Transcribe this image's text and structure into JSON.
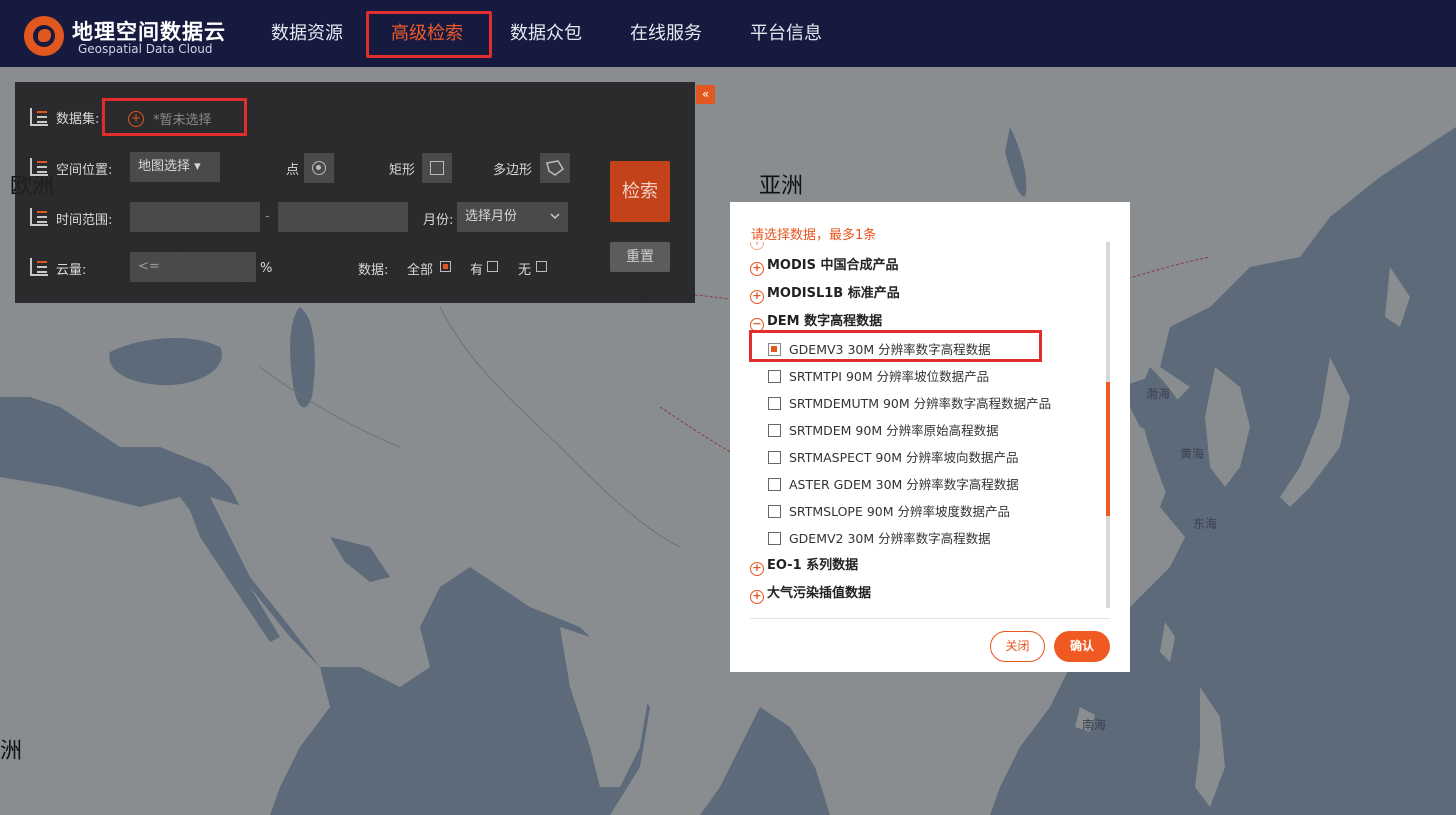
{
  "header": {
    "logo_cn": "地理空间数据云",
    "logo_en": "Geospatial Data Cloud",
    "nav": [
      "数据资源",
      "高级检索",
      "数据众包",
      "在线服务",
      "平台信息"
    ],
    "active_nav": "高级检索"
  },
  "map": {
    "continents": [
      "欧洲",
      "亚洲",
      "洲"
    ],
    "seas": [
      "渤海",
      "黄海",
      "东海",
      "南海"
    ]
  },
  "search_panel": {
    "collapse_icon": "«",
    "dataset_label": "数据集:",
    "dataset_placeholder": "*暂未选择",
    "location_label": "空间位置:",
    "map_select": "地图选择 ▾",
    "point_label": "点",
    "rect_label": "矩形",
    "polygon_label": "多边形",
    "time_label": "时间范围:",
    "time_sep": "-",
    "month_label": "月份:",
    "month_select": "选择月份",
    "cloud_label": "云量:",
    "cloud_placeholder": "<=",
    "cloud_unit": "%",
    "data_label": "数据:",
    "data_all": "全部",
    "data_yes": "有",
    "data_no": "无",
    "search_button": "检索",
    "reset_button": "重置"
  },
  "dialog": {
    "title": "请选择数据，最多1条",
    "categories": [
      {
        "label": "MODIS 中国合成产品",
        "expanded": false
      },
      {
        "label": "MODISL1B 标准产品",
        "expanded": false
      },
      {
        "label": "DEM 数字高程数据",
        "expanded": true
      },
      {
        "label": "EO-1 系列数据",
        "expanded": false
      },
      {
        "label": "大气污染插值数据",
        "expanded": false
      }
    ],
    "items": [
      {
        "label": "GDEMV3 30M 分辨率数字高程数据",
        "checked": true
      },
      {
        "label": "SRTMTPI 90M 分辨率坡位数据产品",
        "checked": false
      },
      {
        "label": "SRTMDEMUTM 90M 分辨率数字高程数据产品",
        "checked": false
      },
      {
        "label": "SRTMDEM 90M 分辨率原始高程数据",
        "checked": false
      },
      {
        "label": "SRTMASPECT 90M 分辨率坡向数据产品",
        "checked": false
      },
      {
        "label": "ASTER GDEM 30M 分辨率数字高程数据",
        "checked": false
      },
      {
        "label": "SRTMSLOPE 90M 分辨率坡度数据产品",
        "checked": false
      },
      {
        "label": "GDEMV2 30M 分辨率数字高程数据",
        "checked": false
      }
    ],
    "close_button": "关闭",
    "confirm_button": "确认"
  },
  "colors": {
    "header_bg": "#161a3e",
    "accent": "#f05a22",
    "highlight_border": "#e02e2e",
    "land": "#8a8d90",
    "sea": "#5d6a7a"
  }
}
